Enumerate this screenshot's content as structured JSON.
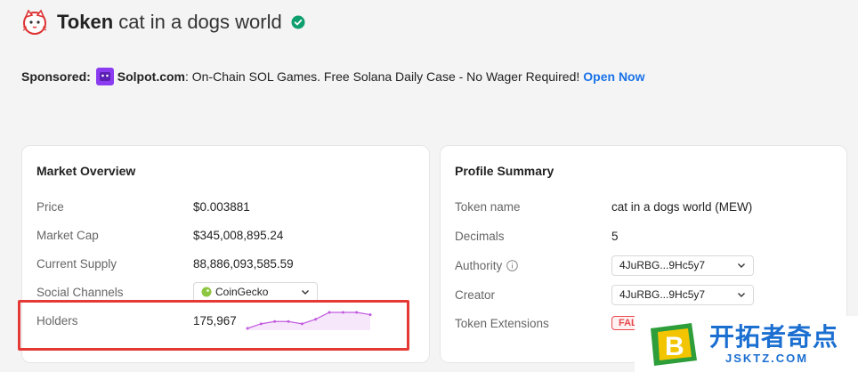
{
  "header": {
    "prefix": "Token",
    "name": "cat in a dogs world",
    "logo_icon": "cat-face-icon",
    "verified_icon": "check-badge-icon",
    "verified_color": "#0e9f6e"
  },
  "sponsored": {
    "label": "Sponsored:",
    "brand": "Solpot.com",
    "text": ": On-Chain SOL Games. Free Solana Daily Case - No Wager Required!",
    "link": "Open Now",
    "link_color": "#1a73e8"
  },
  "market": {
    "title": "Market Overview",
    "rows": [
      {
        "label": "Price",
        "value": "$0.003881"
      },
      {
        "label": "Market Cap",
        "value": "$345,008,895.24"
      },
      {
        "label": "Current Supply",
        "value": "88,886,093,585.59"
      },
      {
        "label": "Social Channels",
        "value": "CoinGecko"
      },
      {
        "label": "Holders",
        "value": "175,967"
      }
    ],
    "holders_trend": [
      2,
      4,
      5,
      5,
      4,
      6,
      9,
      9,
      9,
      8
    ]
  },
  "profile": {
    "title": "Profile Summary",
    "rows": [
      {
        "label": "Token name",
        "value": "cat in a dogs world (MEW)"
      },
      {
        "label": "Decimals",
        "value": "5"
      },
      {
        "label": "Authority",
        "value": "4JuRBG...9Hc5y7"
      },
      {
        "label": "Creator",
        "value": "4JuRBG...9Hc5y7"
      },
      {
        "label": "Token Extensions",
        "value": "FALSE"
      }
    ]
  },
  "watermark": {
    "text_cn": "开拓者奇点",
    "text_en": "JSKTZ.COM",
    "color": "#1b6fd1"
  },
  "colors": {
    "highlight": "#e53935",
    "sparkline": "#c25be0"
  }
}
